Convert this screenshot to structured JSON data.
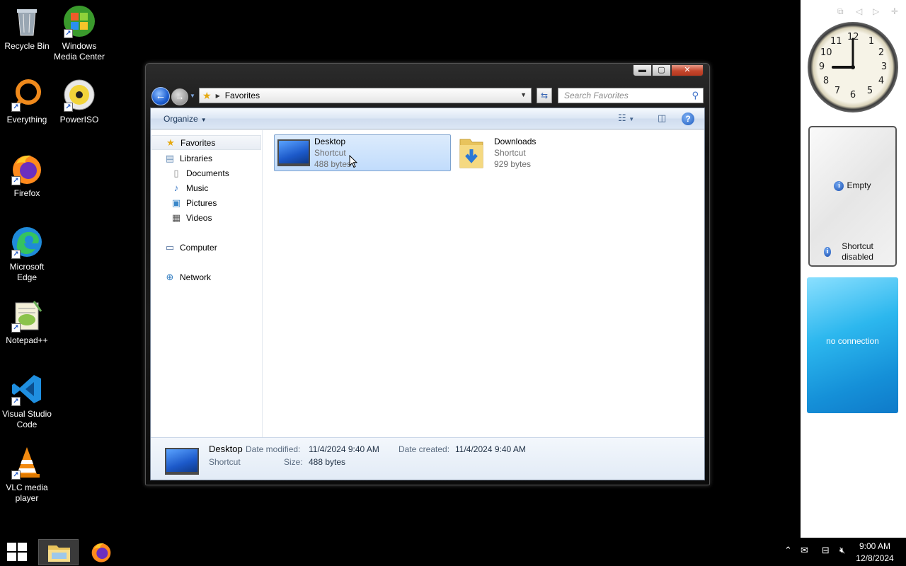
{
  "desktop_icons": [
    {
      "label": "Recycle Bin",
      "icon": "recycle-bin-icon"
    },
    {
      "label": "Windows Media Center",
      "icon": "windows-media-center-icon"
    },
    {
      "label": "Everything",
      "icon": "everything-icon"
    },
    {
      "label": "PowerISO",
      "icon": "poweriso-icon"
    },
    {
      "label": "Firefox",
      "icon": "firefox-icon"
    },
    {
      "label": "Microsoft Edge",
      "icon": "edge-icon"
    },
    {
      "label": "Notepad++",
      "icon": "notepadpp-icon"
    },
    {
      "label": "Visual Studio Code",
      "icon": "vscode-icon"
    },
    {
      "label": "VLC media player",
      "icon": "vlc-icon"
    }
  ],
  "window": {
    "caption_buttons": {
      "minimize": "▬",
      "maximize": "▢",
      "close": "✕"
    },
    "address": {
      "location": "Favorites"
    },
    "search": {
      "placeholder": "Search Favorites"
    },
    "toolbar": {
      "organize": "Organize"
    }
  },
  "nav_pane": {
    "items": [
      {
        "label": "Favorites",
        "icon": "star-icon",
        "selected": true
      },
      {
        "label": "Libraries",
        "icon": "libraries-icon"
      },
      {
        "label": "Documents",
        "icon": "documents-icon"
      },
      {
        "label": "Music",
        "icon": "music-icon"
      },
      {
        "label": "Pictures",
        "icon": "pictures-icon"
      },
      {
        "label": "Videos",
        "icon": "videos-icon"
      },
      {
        "label": "Computer",
        "icon": "computer-icon"
      },
      {
        "label": "Network",
        "icon": "network-icon"
      }
    ]
  },
  "files": [
    {
      "name": "Desktop",
      "type": "Shortcut",
      "size": "488 bytes",
      "selected": true
    },
    {
      "name": "Downloads",
      "type": "Shortcut",
      "size": "929 bytes",
      "selected": false
    }
  ],
  "details": {
    "name": "Desktop",
    "type": "Shortcut",
    "date_modified_label": "Date modified:",
    "date_modified": "11/4/2024 9:40 AM",
    "date_created_label": "Date created:",
    "date_created": "11/4/2024 9:40 AM",
    "size_label": "Size:",
    "size": "488 bytes"
  },
  "gadgets": {
    "clock": {
      "numbers": [
        "12",
        "1",
        "2",
        "3",
        "4",
        "5",
        "6",
        "7",
        "8",
        "9",
        "10",
        "11"
      ],
      "time": "9:00"
    },
    "slideshow": {
      "row1": "Empty",
      "row2": "Shortcut disabled"
    },
    "weather": {
      "status": "no connection"
    }
  },
  "taskbar": {
    "time": "9:00 AM",
    "date": "12/8/2024",
    "tray_icons": [
      "chevron-up-icon",
      "action-center-icon",
      "network-icon",
      "volume-muted-icon"
    ]
  },
  "colors": {
    "selection_bg": "#c9e0fc",
    "selection_border": "#7da2ce",
    "weather_blue": "#2cb7ee"
  }
}
